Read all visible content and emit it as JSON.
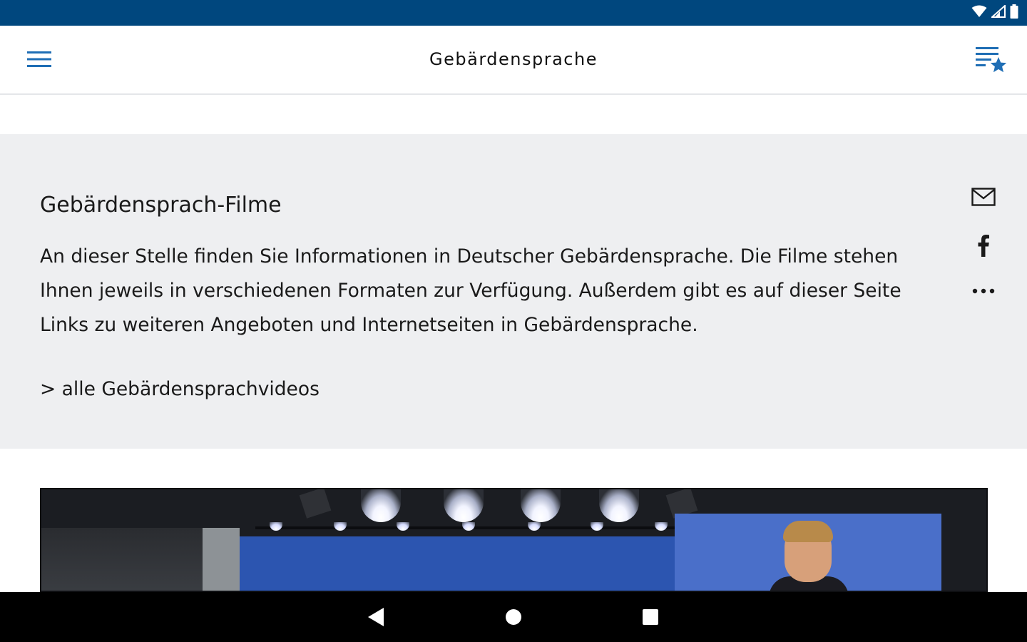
{
  "colors": {
    "status_bar": "#00477e",
    "accent": "#1f6eb5",
    "panel_background": "#eeeff1",
    "nav_bar": "#000000"
  },
  "status_bar": {
    "icons": [
      "wifi-icon",
      "cell-signal-icon",
      "battery-icon"
    ]
  },
  "app_bar": {
    "title": "Gebärdensprache",
    "menu_icon": "hamburger-menu-icon",
    "favorites_icon": "playlist-star-icon"
  },
  "article": {
    "heading": "Gebärdensprach-Filme",
    "body": "An dieser Stelle finden Sie Informationen in Deutscher Gebärdensprache. Die Filme stehen Ihnen jeweils in verschiedenen Formaten zur Verfügung. Außerdem gibt es auf dieser Seite Links zu weiteren Angeboten und Internetseiten in Gebärdensprache.",
    "link": "> alle Gebärdensprachvideos"
  },
  "share": {
    "icons": [
      "mail-icon",
      "facebook-icon",
      "more-horizontal-icon"
    ]
  },
  "video": {
    "thumbnail": "sign-language-video-thumbnail"
  },
  "nav_bar": {
    "icons": [
      "back-icon",
      "home-icon",
      "recents-icon"
    ]
  }
}
